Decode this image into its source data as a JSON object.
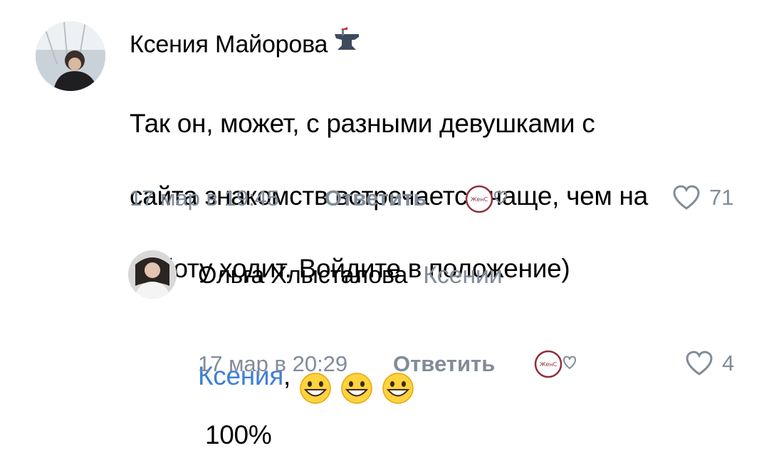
{
  "comments": [
    {
      "author": "Ксения Майорова",
      "badge_icon": "anvil-badge-icon",
      "text_lines": [
        "Так он, может, с разными девушками с",
        "сайта знакомств встречается чаще, чем на",
        "работу ходит. Войдите в положение)"
      ],
      "date": "17 мар в 19:45",
      "reply_label": "Ответить",
      "gift_label": "ЖенС",
      "likes": "71"
    },
    {
      "author": "Ольга Хлысталова",
      "reply_to": "Ксении",
      "mention": "Ксения",
      "mention_suffix": ",",
      "emoji_icon": "grinning-face-icon",
      "text_after": "100%",
      "date": "17 мар в 20:29",
      "reply_label": "Ответить",
      "gift_label": "ЖенС",
      "likes": "4"
    }
  ],
  "colors": {
    "secondary_text": "#818c99",
    "mention": "#3f7fd6",
    "gift_accent": "#8e2f3c"
  }
}
